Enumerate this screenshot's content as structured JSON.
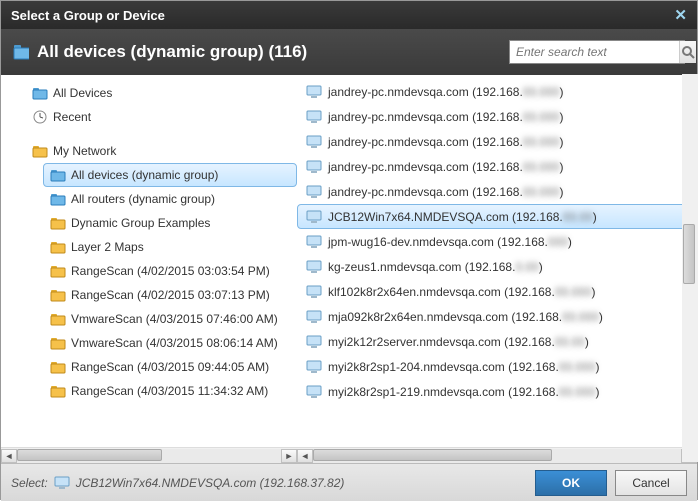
{
  "title": "Select a Group or Device",
  "header": {
    "label": "All devices (dynamic group) (116)",
    "search_placeholder": "Enter search text"
  },
  "tree": {
    "top": [
      {
        "icon": "folder-blue",
        "label": "All Devices"
      },
      {
        "icon": "clock",
        "label": "Recent"
      }
    ],
    "root": {
      "icon": "folder-yellow",
      "label": "My Network"
    },
    "children": [
      {
        "icon": "folder-blue",
        "label": "All devices (dynamic group)",
        "selected": true
      },
      {
        "icon": "folder-blue",
        "label": "All routers (dynamic group)"
      },
      {
        "icon": "folder-yellow",
        "label": "Dynamic Group Examples"
      },
      {
        "icon": "folder-yellow",
        "label": "Layer 2 Maps"
      },
      {
        "icon": "folder-yellow",
        "label": "RangeScan (4/02/2015 03:03:54 PM)"
      },
      {
        "icon": "folder-yellow",
        "label": "RangeScan (4/02/2015 03:07:13 PM)"
      },
      {
        "icon": "folder-yellow",
        "label": "VmwareScan (4/03/2015 07:46:00 AM)"
      },
      {
        "icon": "folder-yellow",
        "label": "VmwareScan (4/03/2015 08:06:14 AM)"
      },
      {
        "icon": "folder-yellow",
        "label": "RangeScan (4/03/2015 09:44:05 AM)"
      },
      {
        "icon": "folder-yellow",
        "label": "RangeScan (4/03/2015 11:34:32 AM)"
      }
    ]
  },
  "list": [
    {
      "name": "jandrey-pc.nmdevsqa.com",
      "ip_pre": "192.168.",
      "ip_blur": "00.000"
    },
    {
      "name": "jandrey-pc.nmdevsqa.com",
      "ip_pre": "192.168.",
      "ip_blur": "00.000"
    },
    {
      "name": "jandrey-pc.nmdevsqa.com",
      "ip_pre": "192.168.",
      "ip_blur": "00.000"
    },
    {
      "name": "jandrey-pc.nmdevsqa.com",
      "ip_pre": "192.168.",
      "ip_blur": "00.000"
    },
    {
      "name": "jandrey-pc.nmdevsqa.com",
      "ip_pre": "192.168.",
      "ip_blur": "00.000"
    },
    {
      "name": "JCB12Win7x64.NMDEVSQA.com",
      "ip_pre": "192.168.",
      "ip_blur": "00.00",
      "selected": true
    },
    {
      "name": "jpm-wug16-dev.nmdevsqa.com",
      "ip_pre": "192.168.",
      "ip_blur": "000"
    },
    {
      "name": "kg-zeus1.nmdevsqa.com",
      "ip_pre": "192.168.",
      "ip_blur": "0.00"
    },
    {
      "name": "klf102k8r2x64en.nmdevsqa.com",
      "ip_pre": "192.168.",
      "ip_blur": "00.000"
    },
    {
      "name": "mja092k8r2x64en.nmdevsqa.com",
      "ip_pre": "192.168.",
      "ip_blur": "00.000"
    },
    {
      "name": "myi2k12r2server.nmdevsqa.com",
      "ip_pre": "192.168.",
      "ip_blur": "00.00"
    },
    {
      "name": "myi2k8r2sp1-204.nmdevsqa.com",
      "ip_pre": "192.168.",
      "ip_blur": "00.000"
    },
    {
      "name": "myi2k8r2sp1-219.nmdevsqa.com",
      "ip_pre": "192.168.",
      "ip_blur": "00.000"
    }
  ],
  "footer": {
    "select_label": "Select:",
    "selected_text": "JCB12Win7x64.NMDEVSQA.com (192.168.37.82)",
    "ok": "OK",
    "cancel": "Cancel"
  }
}
